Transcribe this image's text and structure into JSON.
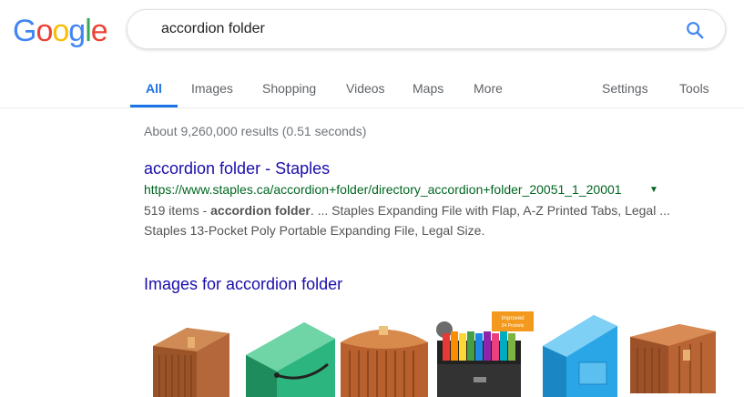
{
  "logo": {
    "letters": [
      "G",
      "o",
      "o",
      "g",
      "l",
      "e"
    ],
    "colors": [
      "#4285F4",
      "#EA4335",
      "#FBBC05",
      "#4285F4",
      "#34A853",
      "#EA4335"
    ]
  },
  "search": {
    "query": "accordion folder",
    "icon": "search-icon",
    "accent": "#4285F4"
  },
  "tabs": {
    "all": "All",
    "images": "Images",
    "shopping": "Shopping",
    "videos": "Videos",
    "maps": "Maps",
    "more": "More",
    "settings": "Settings",
    "tools": "Tools"
  },
  "stats": "About 9,260,000 results (0.51 seconds)",
  "result": {
    "title": "accordion folder - Staples",
    "url": "https://www.staples.ca/accordion+folder/directory_accordion+folder_20051_1_20001",
    "arrow": "▼",
    "snippet_prefix": "519 items - ",
    "snippet_bold": "accordion folder",
    "snippet_rest": ". ... Staples Expanding File with Flap, A-Z Printed Tabs, Legal ...",
    "snippet_line2": "Staples 13-Pocket Poly Portable Expanding File, Legal Size."
  },
  "images_header": "Images for accordion folder",
  "image_badge": {
    "line1": "Improved",
    "line2": "24 Pockets"
  },
  "colors": {
    "link": "#1a0dab",
    "url_green": "#006621",
    "tab_active": "#1a73e8"
  }
}
